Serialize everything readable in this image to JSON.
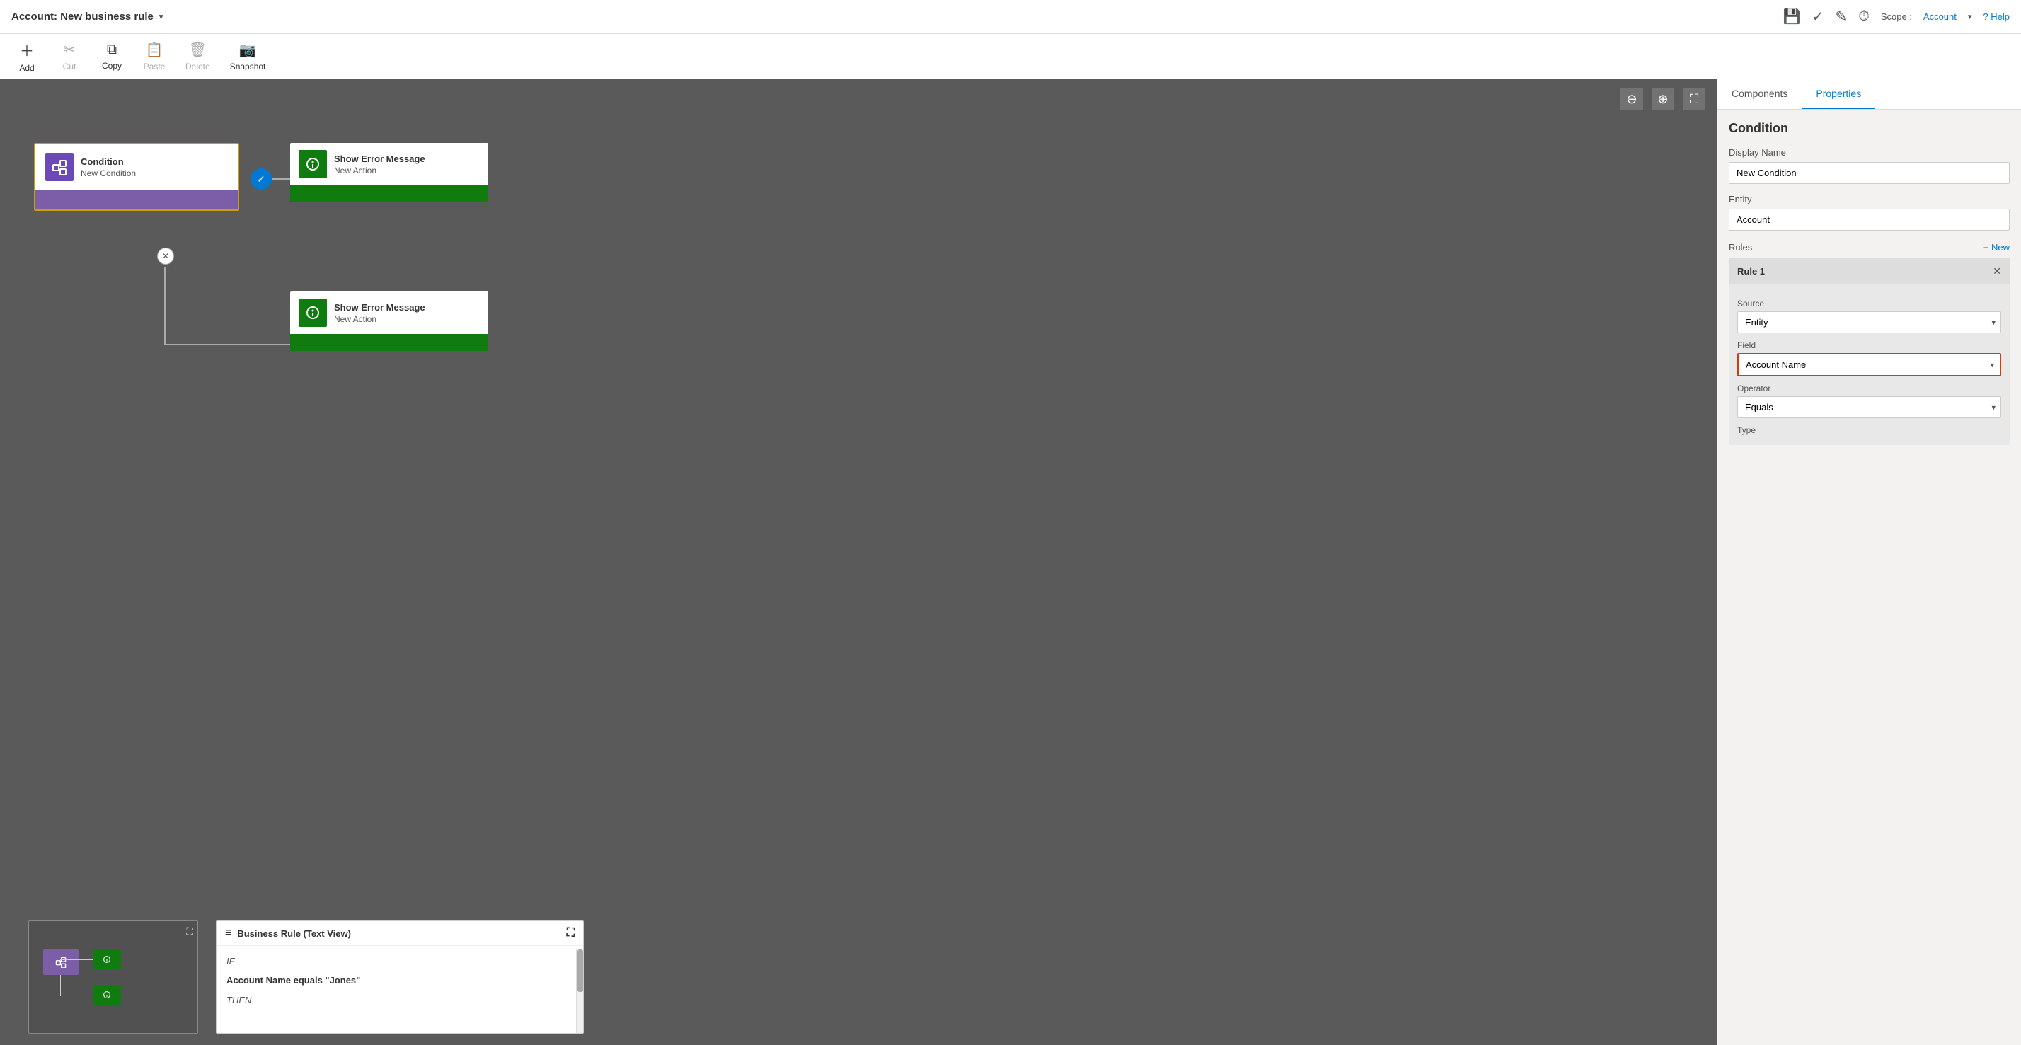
{
  "titleBar": {
    "title": "Account: New business rule",
    "chevron": "▾",
    "saveIcon": "💾",
    "checkIcon": "✓",
    "editIcon": "✎",
    "clockIcon": "⏱",
    "scopeLabel": "Scope :",
    "scopeValue": "Account",
    "scopeChevron": "▾",
    "helpLabel": "? Help"
  },
  "toolbar": {
    "addLabel": "Add",
    "cutLabel": "Cut",
    "copyLabel": "Copy",
    "pasteLabel": "Paste",
    "deleteLabel": "Delete",
    "snapshotLabel": "Snapshot"
  },
  "canvas": {
    "zoomOutIcon": "⊖",
    "zoomInIcon": "⊕",
    "fitIcon": "⛶",
    "conditionNode": {
      "type": "Condition",
      "name": "New Condition"
    },
    "actionNode1": {
      "type": "Show Error Message",
      "name": "New Action"
    },
    "actionNode2": {
      "type": "Show Error Message",
      "name": "New Action"
    }
  },
  "textView": {
    "title": "Business Rule (Text View)",
    "expandIcon": "⛶",
    "listIcon": "≡",
    "if": "IF",
    "conditionText": "Account Name equals \"Jones\"",
    "then": "THEN"
  },
  "rightPanel": {
    "tab1": "Components",
    "tab2": "Properties",
    "sectionTitle": "Condition",
    "displayNameLabel": "Display Name",
    "displayNameValue": "New Condition",
    "entityLabel": "Entity",
    "entityValue": "Account",
    "rulesLabel": "Rules",
    "newLabel": "+ New",
    "rule1": {
      "label": "Rule 1",
      "closeIcon": "✕",
      "sourceLabel": "Source",
      "sourceValue": "Entity",
      "fieldLabel": "Field",
      "fieldValue": "Account Name",
      "operatorLabel": "Operator",
      "operatorValue": "Equals",
      "typeLabel": "Type"
    }
  }
}
